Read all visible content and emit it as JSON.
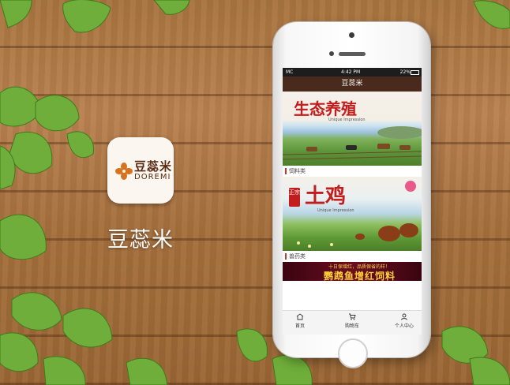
{
  "app": {
    "name": "豆蕊米",
    "icon_cn": "豆蕊米",
    "icon_en": "DOREMI"
  },
  "phone": {
    "status": {
      "carrier": "MC",
      "time": "4:42 PM",
      "battery": "22%"
    },
    "title": "豆蕊米",
    "banner1": {
      "title": "生态养殖",
      "subtitle": "Unique Impression"
    },
    "section1": "饲料类",
    "banner2": {
      "tag": "正宗",
      "title": "土鸡",
      "subtitle": "Unique Impression"
    },
    "section2": "兽药类",
    "banner3": {
      "top": "十日保增红，品质保省的样！",
      "main": "鹦鹉鱼增红饲料"
    },
    "tabs": [
      {
        "label": "首页",
        "icon": "home-icon"
      },
      {
        "label": "购物车",
        "icon": "cart-icon"
      },
      {
        "label": "个人中心",
        "icon": "user-icon"
      }
    ]
  },
  "colors": {
    "titlebar": "#4a2a1c",
    "accent": "#c21c1c",
    "wood": "#a8743f"
  }
}
